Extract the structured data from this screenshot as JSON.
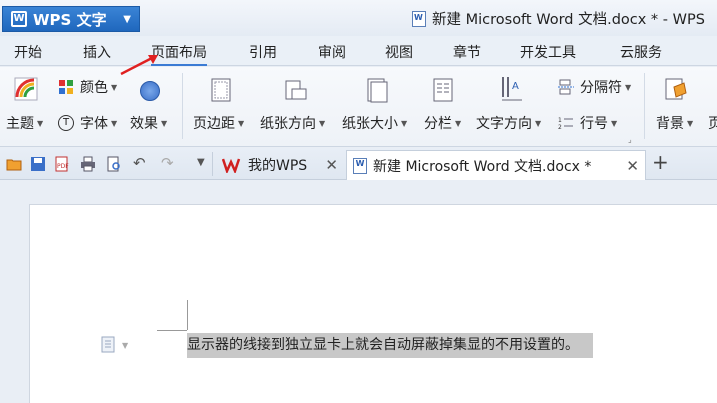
{
  "app": {
    "name": "WPS 文字",
    "window_title": "新建 Microsoft Word 文档.docx * - WPS"
  },
  "menu": {
    "tabs": [
      "开始",
      "插入",
      "页面布局",
      "引用",
      "审阅",
      "视图",
      "章节",
      "开发工具",
      "云服务"
    ],
    "active": "页面布局"
  },
  "ribbon": {
    "theme": "主题",
    "color": "颜色",
    "font": "字体",
    "effect": "效果",
    "margins": "页边距",
    "orientation": "纸张方向",
    "size": "纸张大小",
    "columns": "分栏",
    "text_direction": "文字方向",
    "breaks": "分隔符",
    "line_numbers": "行号",
    "background": "背景",
    "page_cut": "页"
  },
  "tabs": {
    "home_tab": "我的WPS",
    "doc_tab": "新建 Microsoft Word 文档.docx *",
    "new_tab": "+"
  },
  "document": {
    "selected_text": "显示器的线接到独立显卡上就会自动屏蔽掉集显的不用设置的。"
  },
  "colors": {
    "accent": "#3b7bd4",
    "wps_button": "#2a73c9",
    "selection": "#c8c8c8",
    "annotation_arrow": "#e02020"
  }
}
